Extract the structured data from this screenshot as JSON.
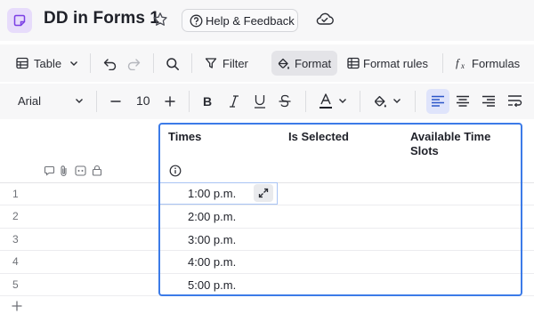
{
  "header": {
    "doc_title": "DD in Forms 1",
    "help_label": "Help & Feedback",
    "accent": "#e7dcfb"
  },
  "toolbar": {
    "table_label": "Table",
    "filter_label": "Filter",
    "format_label": "Format",
    "format_rules_label": "Format rules",
    "formulas_label": "Formulas"
  },
  "format_bar": {
    "font": "Arial",
    "size": "10",
    "text_color": "#1f2129"
  },
  "grid": {
    "columns": [
      "Times",
      "Is Selected",
      "Available Time Slots"
    ],
    "rows": [
      {
        "num": "1",
        "time": "1:00 p.m."
      },
      {
        "num": "2",
        "time": "2:00 p.m."
      },
      {
        "num": "3",
        "time": "3:00 p.m."
      },
      {
        "num": "4",
        "time": "4:00 p.m."
      },
      {
        "num": "5",
        "time": "5:00 p.m."
      }
    ],
    "selection_color": "#3c7be8"
  }
}
